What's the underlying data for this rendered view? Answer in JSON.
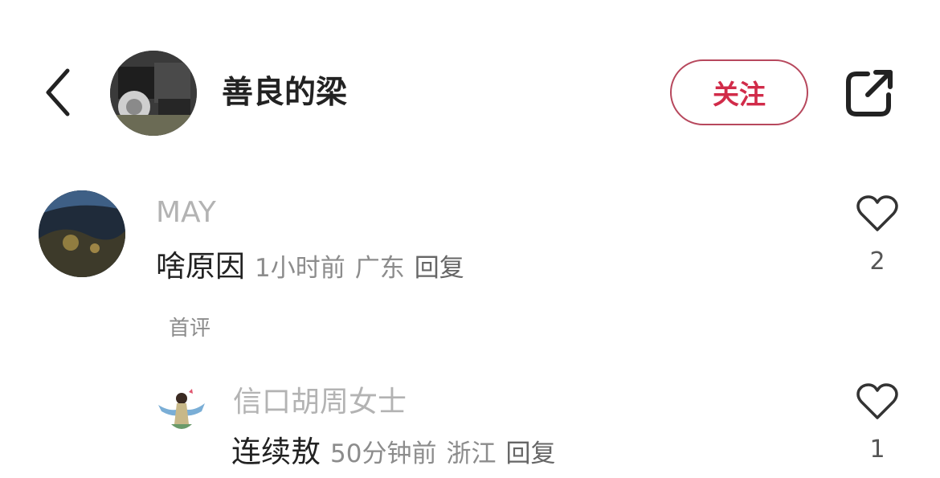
{
  "header": {
    "back_icon": "chevron-left-icon",
    "author_name": "善良的梁",
    "follow_label": "关注",
    "share_icon": "share-external-icon",
    "accent_color": "#d12b49"
  },
  "comments": [
    {
      "username": "MAY",
      "text": "啥原因",
      "time": "1小时前",
      "location": "广东",
      "reply_label": "回复",
      "tag": "首评",
      "likes": "2",
      "like_icon": "heart-outline-icon"
    },
    {
      "username": "信口胡周女士",
      "text": "连续敖",
      "time": "50分钟前",
      "location": "浙江",
      "reply_label": "回复",
      "likes": "1",
      "like_icon": "heart-outline-icon"
    }
  ]
}
